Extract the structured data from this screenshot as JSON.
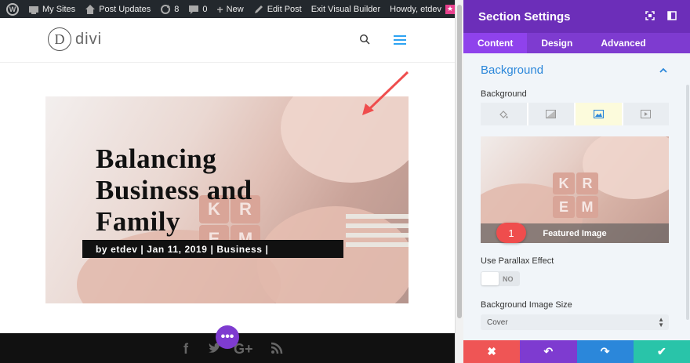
{
  "admin_bar": {
    "my_sites": "My Sites",
    "post_updates": "Post Updates",
    "updates_count": "8",
    "comments_count": "0",
    "new": "New",
    "edit_post": "Edit Post",
    "exit_builder": "Exit Visual Builder",
    "howdy": "Howdy, etdev"
  },
  "site": {
    "logo_letter": "D",
    "logo_text": "divi"
  },
  "post": {
    "title": "Balancing Business and Family",
    "meta": "by etdev | Jan 11, 2019 | Business |",
    "image_letters": [
      "K",
      "R",
      "E",
      "M"
    ]
  },
  "footer": {
    "icons": [
      "facebook-icon",
      "twitter-icon",
      "google-plus-icon",
      "rss-icon"
    ],
    "fab_label": "•••"
  },
  "panel": {
    "title": "Section Settings",
    "tabs": [
      {
        "label": "Content",
        "active": true
      },
      {
        "label": "Design",
        "active": false
      },
      {
        "label": "Advanced",
        "active": false
      }
    ],
    "section_title": "Background",
    "background_label": "Background",
    "background_tabs": [
      "color-icon",
      "gradient-icon",
      "image-icon",
      "video-icon"
    ],
    "active_background_tab": "image-icon",
    "featured_image_label": "Featured Image",
    "badge_number": "1",
    "parallax_label": "Use Parallax Effect",
    "parallax_value": "NO",
    "image_size_label": "Background Image Size",
    "image_size_value": "Cover"
  },
  "actions": [
    {
      "name": "discard",
      "glyph": "✖",
      "color": "#ef5555"
    },
    {
      "name": "undo",
      "glyph": "↶",
      "color": "#7e3bd0"
    },
    {
      "name": "redo",
      "glyph": "↷",
      "color": "#2b87da"
    },
    {
      "name": "save",
      "glyph": "✔",
      "color": "#29c4a9"
    }
  ],
  "colors": {
    "admin_bar": "#23282d",
    "panel_header": "#6c2eb9",
    "panel_tabs": "#7e3bd0",
    "accent_blue": "#2b87da",
    "fab": "#7e3bd0",
    "badge": "#ef4d4d",
    "arrow": "#ef4d4d"
  }
}
